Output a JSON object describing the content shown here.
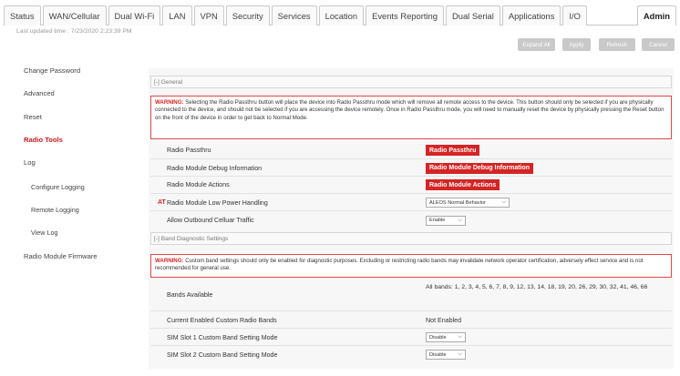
{
  "tabs": [
    {
      "label": "Status"
    },
    {
      "label": "WAN/Cellular"
    },
    {
      "label": "Dual Wi-Fi"
    },
    {
      "label": "LAN"
    },
    {
      "label": "VPN"
    },
    {
      "label": "Security"
    },
    {
      "label": "Services"
    },
    {
      "label": "Location"
    },
    {
      "label": "Events Reporting"
    },
    {
      "label": "Dual Serial"
    },
    {
      "label": "Applications"
    },
    {
      "label": "I/O"
    },
    {
      "label": "Admin"
    }
  ],
  "last_updated": "Last updated time : 7/23/2020 2:23:39 PM",
  "toolbar": {
    "expand_all": "Expand All",
    "apply": "Apply",
    "refresh": "Refresh",
    "cancel": "Cancel"
  },
  "sidebar": {
    "items": [
      {
        "label": "Change Password"
      },
      {
        "label": "Advanced"
      },
      {
        "label": "Reset"
      },
      {
        "label": "Radio Tools"
      },
      {
        "label": "Log"
      },
      {
        "label": "Configure Logging"
      },
      {
        "label": "Remote Logging"
      },
      {
        "label": "View Log"
      },
      {
        "label": "Radio Module Firmware"
      }
    ]
  },
  "general": {
    "header": "[-] General",
    "warning_label": "WARNING:",
    "warning_text": "Selecting the Radio Passthru button will place the device into Radio Passthru mode which will remove all remote access to the device. This button should only be selected if you are physically connected to the device, and should not be selected if you are accessing the device remotely. Once in Radio Passthru mode, you will need to manually reset the device by physically pressing the Reset button on the front of the device in order to get back to Normal Mode.",
    "rows": {
      "passthru_label": "Radio Passthru",
      "passthru_button": "Radio Passthru",
      "debug_label": "Radio Module Debug Information",
      "debug_button": "Radio Module Debug Information",
      "actions_label": "Radio Module Actions",
      "actions_button": "Radio Module Actions",
      "at_marker": "AT",
      "low_power_label": "Radio Module Low Power Handling",
      "low_power_value": "ALEOS Normal Behavior",
      "outbound_label": "Allow Outbound Celluar Traffic",
      "outbound_value": "Enable"
    }
  },
  "band": {
    "header": "[-] Band Diagnostic Settings",
    "warning_label": "WARNING:",
    "warning_text": "Custom band settings should only be enabled for diagnostic purposes. Excluding or restricting radio bands may invalidate network operator certification, adversely effect service and is not recommended for general use.",
    "rows": {
      "bands_label": "Bands Available",
      "bands_value": "All bands: 1, 2, 3, 4, 5, 6, 7, 8, 9, 12, 13, 14, 18, 19, 20, 26, 29, 30, 32, 41, 46, 66",
      "current_label": "Current Enabled Custom Radio Bands",
      "current_value": "Not Enabled",
      "sim1_label": "SIM Slot 1 Custom Band Setting Mode",
      "sim1_value": "Disable",
      "sim2_label": "SIM Slot 2 Custom Band Setting Mode",
      "sim2_value": "Disable"
    }
  }
}
